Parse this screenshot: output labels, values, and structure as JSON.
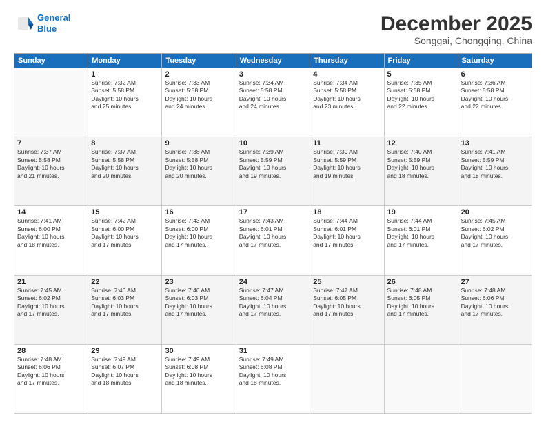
{
  "header": {
    "logo_line1": "General",
    "logo_line2": "Blue",
    "month": "December 2025",
    "location": "Songgai, Chongqing, China"
  },
  "days_of_week": [
    "Sunday",
    "Monday",
    "Tuesday",
    "Wednesday",
    "Thursday",
    "Friday",
    "Saturday"
  ],
  "weeks": [
    [
      {
        "day": "",
        "info": ""
      },
      {
        "day": "1",
        "info": "Sunrise: 7:32 AM\nSunset: 5:58 PM\nDaylight: 10 hours\nand 25 minutes."
      },
      {
        "day": "2",
        "info": "Sunrise: 7:33 AM\nSunset: 5:58 PM\nDaylight: 10 hours\nand 24 minutes."
      },
      {
        "day": "3",
        "info": "Sunrise: 7:34 AM\nSunset: 5:58 PM\nDaylight: 10 hours\nand 24 minutes."
      },
      {
        "day": "4",
        "info": "Sunrise: 7:34 AM\nSunset: 5:58 PM\nDaylight: 10 hours\nand 23 minutes."
      },
      {
        "day": "5",
        "info": "Sunrise: 7:35 AM\nSunset: 5:58 PM\nDaylight: 10 hours\nand 22 minutes."
      },
      {
        "day": "6",
        "info": "Sunrise: 7:36 AM\nSunset: 5:58 PM\nDaylight: 10 hours\nand 22 minutes."
      }
    ],
    [
      {
        "day": "7",
        "info": "Sunrise: 7:37 AM\nSunset: 5:58 PM\nDaylight: 10 hours\nand 21 minutes."
      },
      {
        "day": "8",
        "info": "Sunrise: 7:37 AM\nSunset: 5:58 PM\nDaylight: 10 hours\nand 20 minutes."
      },
      {
        "day": "9",
        "info": "Sunrise: 7:38 AM\nSunset: 5:58 PM\nDaylight: 10 hours\nand 20 minutes."
      },
      {
        "day": "10",
        "info": "Sunrise: 7:39 AM\nSunset: 5:59 PM\nDaylight: 10 hours\nand 19 minutes."
      },
      {
        "day": "11",
        "info": "Sunrise: 7:39 AM\nSunset: 5:59 PM\nDaylight: 10 hours\nand 19 minutes."
      },
      {
        "day": "12",
        "info": "Sunrise: 7:40 AM\nSunset: 5:59 PM\nDaylight: 10 hours\nand 18 minutes."
      },
      {
        "day": "13",
        "info": "Sunrise: 7:41 AM\nSunset: 5:59 PM\nDaylight: 10 hours\nand 18 minutes."
      }
    ],
    [
      {
        "day": "14",
        "info": "Sunrise: 7:41 AM\nSunset: 6:00 PM\nDaylight: 10 hours\nand 18 minutes."
      },
      {
        "day": "15",
        "info": "Sunrise: 7:42 AM\nSunset: 6:00 PM\nDaylight: 10 hours\nand 17 minutes."
      },
      {
        "day": "16",
        "info": "Sunrise: 7:43 AM\nSunset: 6:00 PM\nDaylight: 10 hours\nand 17 minutes."
      },
      {
        "day": "17",
        "info": "Sunrise: 7:43 AM\nSunset: 6:01 PM\nDaylight: 10 hours\nand 17 minutes."
      },
      {
        "day": "18",
        "info": "Sunrise: 7:44 AM\nSunset: 6:01 PM\nDaylight: 10 hours\nand 17 minutes."
      },
      {
        "day": "19",
        "info": "Sunrise: 7:44 AM\nSunset: 6:01 PM\nDaylight: 10 hours\nand 17 minutes."
      },
      {
        "day": "20",
        "info": "Sunrise: 7:45 AM\nSunset: 6:02 PM\nDaylight: 10 hours\nand 17 minutes."
      }
    ],
    [
      {
        "day": "21",
        "info": "Sunrise: 7:45 AM\nSunset: 6:02 PM\nDaylight: 10 hours\nand 17 minutes."
      },
      {
        "day": "22",
        "info": "Sunrise: 7:46 AM\nSunset: 6:03 PM\nDaylight: 10 hours\nand 17 minutes."
      },
      {
        "day": "23",
        "info": "Sunrise: 7:46 AM\nSunset: 6:03 PM\nDaylight: 10 hours\nand 17 minutes."
      },
      {
        "day": "24",
        "info": "Sunrise: 7:47 AM\nSunset: 6:04 PM\nDaylight: 10 hours\nand 17 minutes."
      },
      {
        "day": "25",
        "info": "Sunrise: 7:47 AM\nSunset: 6:05 PM\nDaylight: 10 hours\nand 17 minutes."
      },
      {
        "day": "26",
        "info": "Sunrise: 7:48 AM\nSunset: 6:05 PM\nDaylight: 10 hours\nand 17 minutes."
      },
      {
        "day": "27",
        "info": "Sunrise: 7:48 AM\nSunset: 6:06 PM\nDaylight: 10 hours\nand 17 minutes."
      }
    ],
    [
      {
        "day": "28",
        "info": "Sunrise: 7:48 AM\nSunset: 6:06 PM\nDaylight: 10 hours\nand 17 minutes."
      },
      {
        "day": "29",
        "info": "Sunrise: 7:49 AM\nSunset: 6:07 PM\nDaylight: 10 hours\nand 18 minutes."
      },
      {
        "day": "30",
        "info": "Sunrise: 7:49 AM\nSunset: 6:08 PM\nDaylight: 10 hours\nand 18 minutes."
      },
      {
        "day": "31",
        "info": "Sunrise: 7:49 AM\nSunset: 6:08 PM\nDaylight: 10 hours\nand 18 minutes."
      },
      {
        "day": "",
        "info": ""
      },
      {
        "day": "",
        "info": ""
      },
      {
        "day": "",
        "info": ""
      }
    ]
  ]
}
